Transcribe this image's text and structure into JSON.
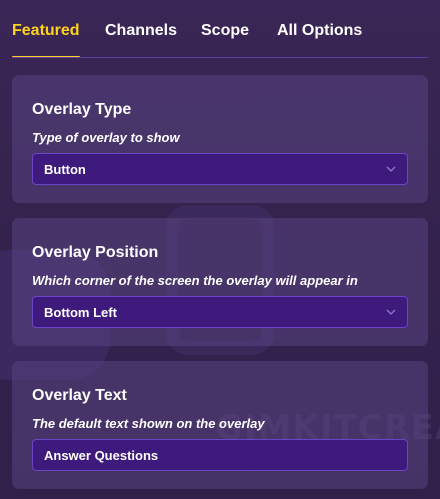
{
  "tabs": [
    {
      "label": "Featured",
      "active": true
    },
    {
      "label": "Channels",
      "active": false
    },
    {
      "label": "Scope",
      "active": false
    },
    {
      "label": "All Options",
      "active": false
    }
  ],
  "colors": {
    "accent": "#ffd21e",
    "field_bg": "#3e1a7c",
    "field_border": "#6a45c8"
  },
  "settings": {
    "overlay_type": {
      "title": "Overlay Type",
      "description": "Type of overlay to show",
      "value": "Button",
      "icon": "chevron-down-icon"
    },
    "overlay_position": {
      "title": "Overlay Position",
      "description": "Which corner of the screen the overlay will appear in",
      "value": "Bottom Left",
      "icon": "chevron-down-icon"
    },
    "overlay_text": {
      "title": "Overlay Text",
      "description": "The default text shown on the overlay",
      "value": "Answer Questions"
    }
  }
}
